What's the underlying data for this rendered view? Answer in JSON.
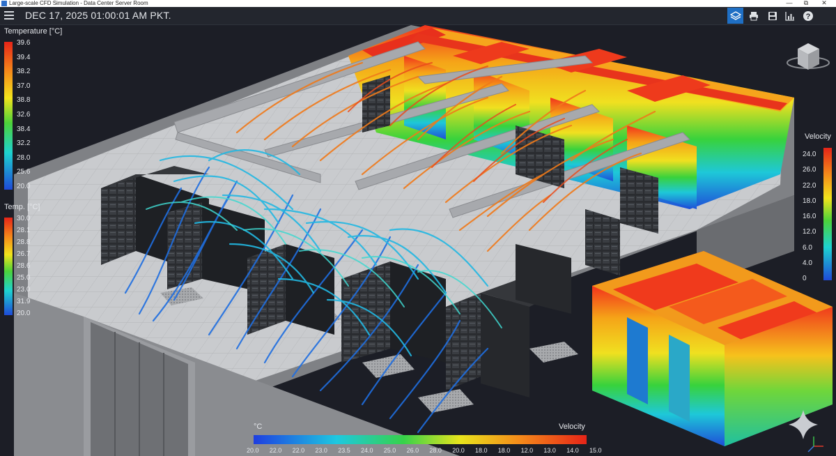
{
  "window": {
    "title": "Large-scale CFD Simulation - Data Center Server Room",
    "controls": [
      "—",
      "⧉",
      "✕"
    ]
  },
  "toolbar": {
    "datetime": "DEC 17, 2025 01:00:01 AM PKT.",
    "buttons": [
      "layers-icon",
      "print-icon",
      "save-icon",
      "chart-icon",
      "help-icon"
    ],
    "active_button": "layers-icon",
    "accent": "#1f6fc4"
  },
  "legends": {
    "temperature": {
      "title": "Temperature [°C]",
      "ticks": [
        "39.6",
        "39.4",
        "38.2",
        "37.0",
        "38.8",
        "32.6",
        "38.4",
        "32.2",
        "28.0",
        "25.6",
        "20.0"
      ]
    },
    "temp_small": {
      "title": "Temp. [°C]",
      "ticks": [
        "30.0",
        "28.1",
        "28.8",
        "26.7",
        "28.6",
        "25.0",
        "23.0",
        "31.9",
        "20.0"
      ]
    },
    "velocity": {
      "title": "Velocity",
      "ticks": [
        "24.0",
        "26.0",
        "22.0",
        "18.0",
        "16.0",
        "12.0",
        "6.0",
        "4.0",
        "0"
      ]
    },
    "bottom": {
      "left_title": "°C",
      "right_title": "Velocity",
      "ticks": [
        "20.0",
        "22.0",
        "22.0",
        "23.0",
        "23.5",
        "24.0",
        "25.0",
        "26.0",
        "28.0",
        "20.0",
        "18.0",
        "18.0",
        "12.0",
        "13.0",
        "14.0",
        "15.0"
      ]
    }
  },
  "colors": {
    "background": "#1c1e26",
    "cold": "#1e5bd6",
    "cyan": "#22c8dc",
    "hot": "#f03a1c",
    "orange": "#f07a1a"
  }
}
